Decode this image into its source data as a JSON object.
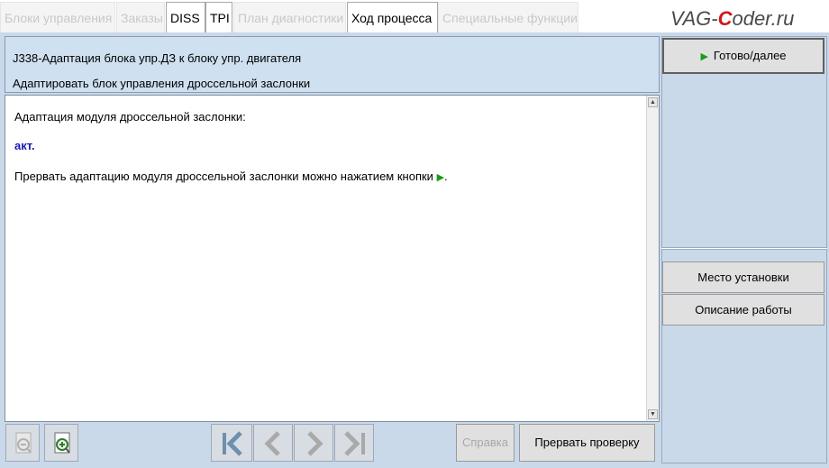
{
  "tabs": [
    {
      "label": "Блоки управления",
      "active": false
    },
    {
      "label": "Заказы",
      "active": false
    },
    {
      "label": "DISS",
      "active": true
    },
    {
      "label": "TPI",
      "active": true
    },
    {
      "label": "План диагностики",
      "active": false
    },
    {
      "label": "Ход процесса",
      "active": true
    },
    {
      "label": "Специальные функции",
      "active": false
    }
  ],
  "watermark": {
    "before": "VAG-",
    "accent": "C",
    "after": "oder.ru"
  },
  "header": {
    "title": "J338-Адаптация блока упр.ДЗ к блоку упр. двигателя",
    "subtitle": "Адаптировать блок управления дроссельной заслонки"
  },
  "content": {
    "line1": "Адаптация модуля дроссельной заслонки:",
    "status": "акт.",
    "line3": "Прервать адаптацию модуля дроссельной заслонки можно нажатием кнопки",
    "line3_end": "."
  },
  "right_panel": {
    "done_button": "Готово/далее",
    "location_button": "Место установки",
    "description_button": "Описание работы"
  },
  "bottom": {
    "help_button": "Справка",
    "abort_button": "Прервать проверку"
  },
  "icons": {
    "zoom_out": "zoom-out-icon",
    "zoom_in": "zoom-in-icon",
    "first": "skip-first-icon",
    "prev": "chevron-left-icon",
    "next": "chevron-right-icon",
    "last": "skip-last-icon",
    "play": "play-triangle-icon"
  },
  "colors": {
    "accent_green": "#1b9a1b",
    "status_blue": "#1a1ab0",
    "panel_bg": "#c9d9ea",
    "logo_red": "#d01818"
  }
}
